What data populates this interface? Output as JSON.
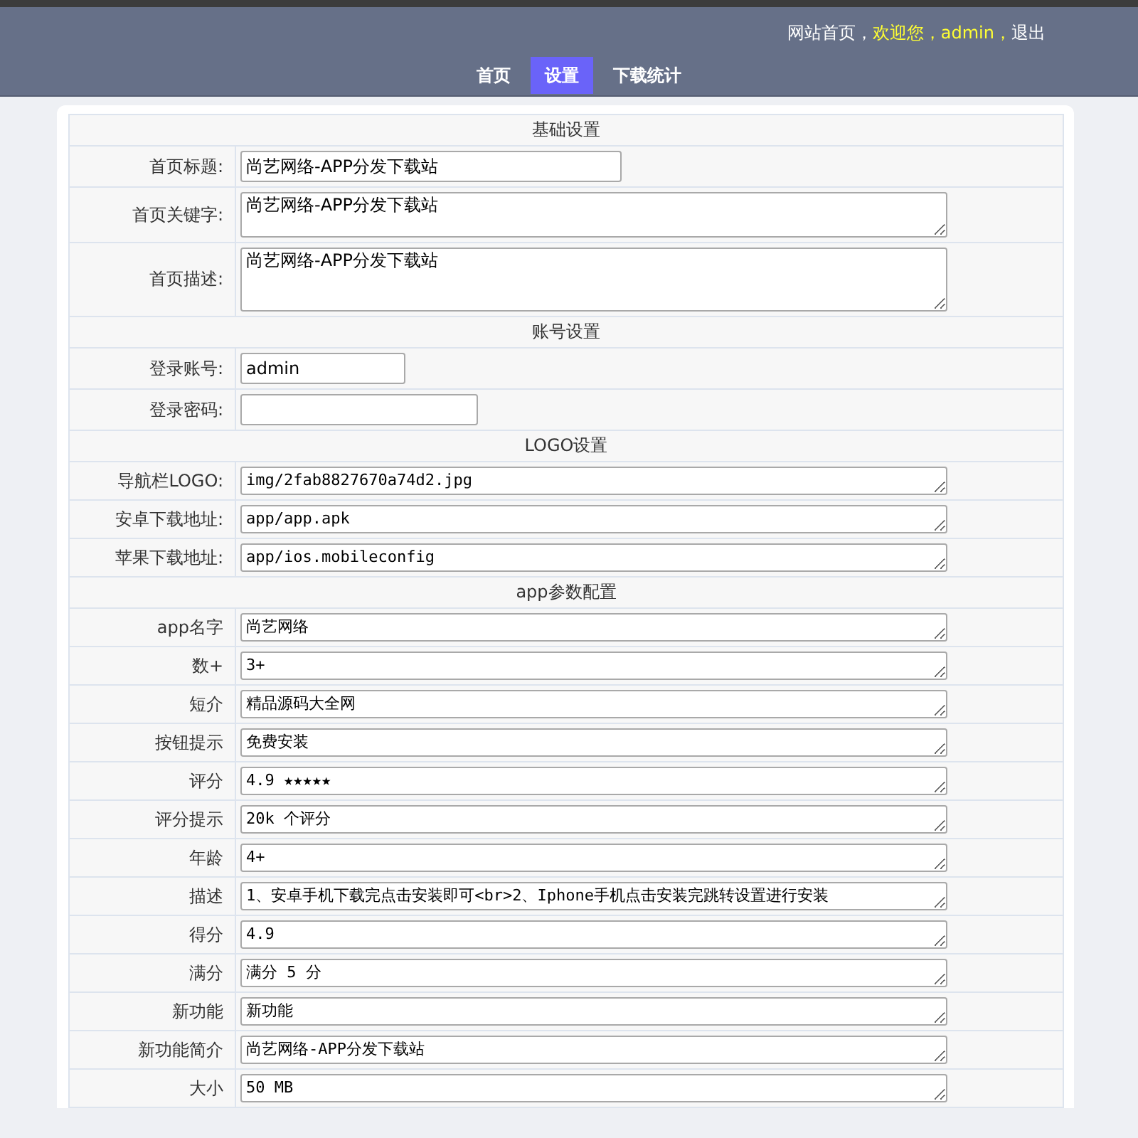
{
  "top_links": [
    {
      "label": "网站首页，",
      "kind": "link"
    },
    {
      "label": "欢迎您，admin，",
      "kind": "greeting"
    },
    {
      "label": "退出",
      "kind": "link"
    }
  ],
  "nav": [
    {
      "label": "首页",
      "selected": false
    },
    {
      "label": "设置",
      "selected": true
    },
    {
      "label": "下载统计",
      "selected": false
    }
  ],
  "sections": [
    {
      "title": "基础设置",
      "rows": [
        {
          "label": "首页标题:",
          "kind": "input",
          "value": "尚艺网络-APP分发下载站"
        },
        {
          "label": "首页关键字:",
          "kind": "textarea",
          "value": "尚艺网络-APP分发下载站"
        },
        {
          "label": "首页描述:",
          "kind": "textarea",
          "value": "尚艺网络-APP分发下载站"
        }
      ]
    },
    {
      "title": "账号设置",
      "rows": [
        {
          "label": "登录账号:",
          "kind": "input",
          "value": "admin"
        },
        {
          "label": "登录密码:",
          "kind": "password"
        }
      ]
    },
    {
      "title": "LOGO设置",
      "rows": [
        {
          "label": "导航栏LOGO:",
          "kind": "textarea",
          "value": "img/2fab8827670a74d2.jpg"
        },
        {
          "label": "安卓下载地址:",
          "kind": "textarea",
          "value": "app/app.apk"
        },
        {
          "label": "苹果下载地址:",
          "kind": "textarea",
          "value": "app/ios.mobileconfig"
        }
      ]
    },
    {
      "title": "app参数配置",
      "rows": [
        {
          "label": "app名字",
          "kind": "textarea",
          "value": "尚艺网络"
        },
        {
          "label": "数+",
          "kind": "textarea",
          "value": "3+"
        },
        {
          "label": "短介",
          "kind": "textarea",
          "value": "精品源码大全网"
        },
        {
          "label": "按钮提示",
          "kind": "textarea",
          "value": "免费安装"
        },
        {
          "label": "评分",
          "kind": "textarea",
          "value": "4.9 ★★★★★"
        },
        {
          "label": "评分提示",
          "kind": "textarea",
          "value": "20k 个评分"
        },
        {
          "label": "年龄",
          "kind": "textarea",
          "value": "4+"
        },
        {
          "label": "描述",
          "kind": "textarea",
          "value": "1、安卓手机下载完点击安装即可<br>2、Iphone手机点击安装完跳转设置进行安装"
        },
        {
          "label": "得分",
          "kind": "textarea",
          "value": "4.9"
        },
        {
          "label": "满分",
          "kind": "textarea",
          "value": "满分 5 分"
        },
        {
          "label": "新功能",
          "kind": "textarea",
          "value": "新功能"
        },
        {
          "label": "新功能简介",
          "kind": "textarea",
          "value": "尚艺网络-APP分发下载站"
        },
        {
          "label": "大小",
          "kind": "textarea",
          "value": "50 MB"
        }
      ]
    }
  ]
}
